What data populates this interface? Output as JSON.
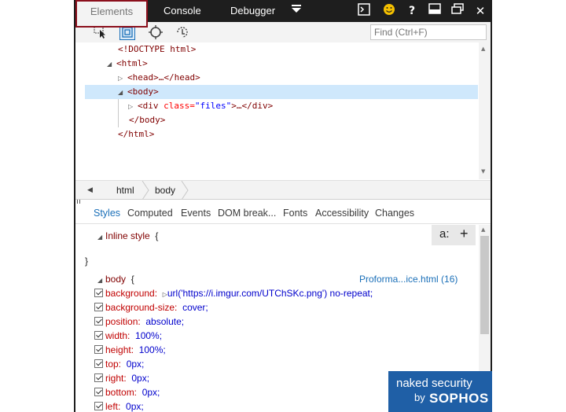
{
  "tabs": [
    {
      "label": "Elements",
      "active": true
    },
    {
      "label": "Console",
      "active": false
    },
    {
      "label": "Debugger",
      "active": false
    }
  ],
  "toolbar_icons": [
    "select-element-icon",
    "highlight-box-icon",
    "target-icon",
    "touch-icon"
  ],
  "find": {
    "placeholder": "Find (Ctrl+F)"
  },
  "dom": {
    "lines": [
      {
        "text": "<!DOCTYPE html>"
      },
      {
        "open": "<html>"
      },
      {
        "head": "<head>…</head>"
      },
      {
        "body": "<body>"
      },
      {
        "div_open": "<div ",
        "attr": "class=",
        "val": "\"files\"",
        "div_close": ">…</div>"
      },
      {
        "close": "</body>"
      },
      {
        "close": "</html>"
      }
    ]
  },
  "breadcrumbs": [
    "html",
    "body"
  ],
  "style_tabs": [
    "Styles",
    "Computed",
    "Events",
    "DOM break...",
    "Fonts",
    "Accessibility",
    "Changes"
  ],
  "styles": {
    "inline": "Inline style",
    "brace_open": "{",
    "brace_close": "}",
    "body_selector": "body",
    "source": "Proforma...ice.html (16)",
    "aplus": "a:",
    "plus": "+",
    "rules": [
      {
        "prop": "background:",
        "val": "url('https://i.imgur.com/UTChSKc.png') no-repeat;"
      },
      {
        "prop": "background-size:",
        "val": "cover;"
      },
      {
        "prop": "position:",
        "val": "absolute;"
      },
      {
        "prop": "width:",
        "val": "100%;"
      },
      {
        "prop": "height:",
        "val": "100%;"
      },
      {
        "prop": "top:",
        "val": "0px;"
      },
      {
        "prop": "right:",
        "val": "0px;"
      },
      {
        "prop": "bottom:",
        "val": "0px;"
      },
      {
        "prop": "left:",
        "val": "0px;"
      }
    ]
  },
  "logo": {
    "line1": "naked security",
    "by": "by",
    "brand": "SOPHOS"
  },
  "colors": {
    "accent": "#1a6fb8",
    "topbar": "#1e1e1e",
    "logo": "#1f5fa6"
  }
}
